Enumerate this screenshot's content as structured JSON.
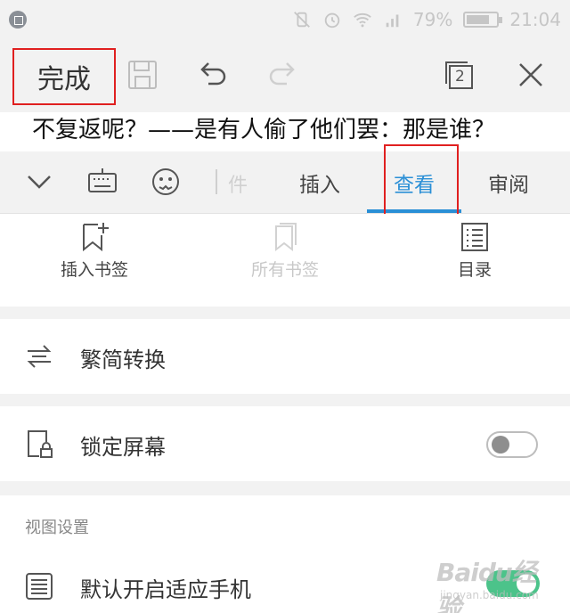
{
  "status_bar": {
    "battery_percent": "79%",
    "time": "21:04",
    "battery_level": 0.79,
    "colors": {
      "icon": "#c6c6c6",
      "background": "#f2f2f2"
    }
  },
  "toolbar": {
    "done_label": "完成",
    "window_count": "2",
    "icons": [
      "save-icon",
      "undo-icon",
      "redo-icon",
      "windows-icon",
      "close-icon"
    ]
  },
  "document": {
    "visible_text": "不复返呢？——是有人偷了他们罢：那是谁？"
  },
  "ribbon": {
    "faded_tab_fragment": "件",
    "tabs": [
      {
        "label": "插入",
        "active": false
      },
      {
        "label": "查看",
        "active": true
      },
      {
        "label": "审阅",
        "active": false
      }
    ],
    "accent_color": "#2a8fd6"
  },
  "tools": [
    {
      "label": "插入书签",
      "icon": "bookmark-add-icon",
      "enabled": true
    },
    {
      "label": "所有书签",
      "icon": "bookmarks-icon",
      "enabled": false
    },
    {
      "label": "目录",
      "icon": "table-of-contents-icon",
      "enabled": true
    }
  ],
  "options": {
    "convert": {
      "label": "繁简转换",
      "icon": "convert-icon"
    },
    "lock_screen": {
      "label": "锁定屏幕",
      "icon": "lock-screen-icon",
      "enabled": false
    }
  },
  "view_settings": {
    "title": "视图设置",
    "fit_phone": {
      "label": "默认开启适应手机",
      "icon": "menu-lines-icon",
      "enabled": true
    }
  },
  "watermark": {
    "main": "Baidu经验",
    "sub": "jingyan.baidu.com"
  },
  "highlight_color": "#e02020"
}
